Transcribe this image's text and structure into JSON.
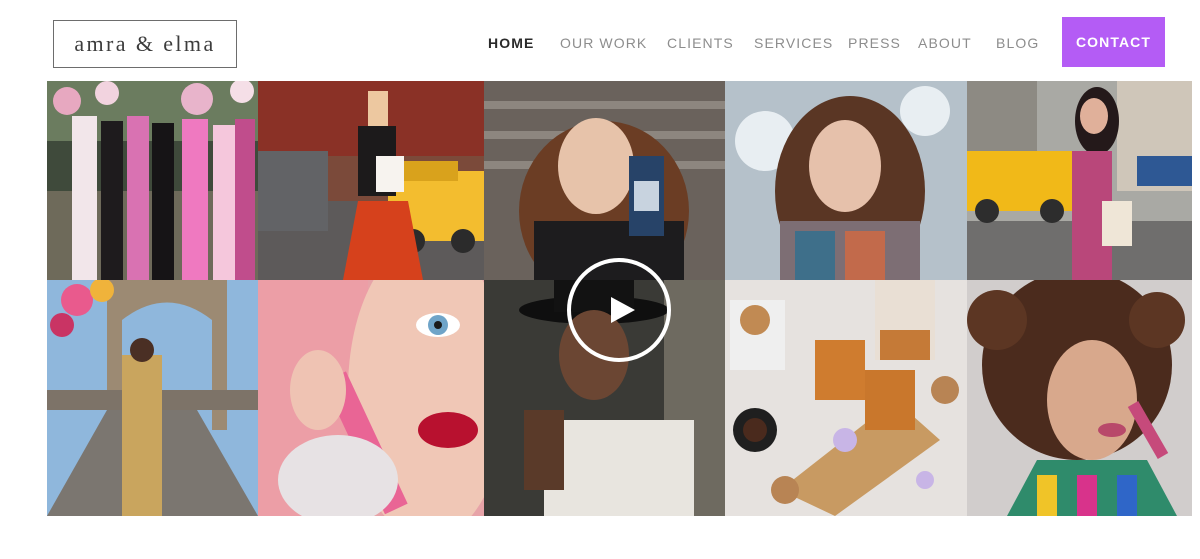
{
  "brand": {
    "logo_text": "amra & elma"
  },
  "nav": {
    "items": [
      {
        "label": "HOME",
        "active": true
      },
      {
        "label": "OUR WORK",
        "active": false
      },
      {
        "label": "CLIENTS",
        "active": false
      },
      {
        "label": "SERVICES",
        "active": false
      },
      {
        "label": "PRESS",
        "active": false
      },
      {
        "label": "ABOUT",
        "active": false
      },
      {
        "label": "BLOG",
        "active": false
      }
    ],
    "cta_label": "CONTACT",
    "cta_color": "#b45cf5"
  },
  "gallery": {
    "tiles": [
      {
        "name": "runway-group-photo"
      },
      {
        "name": "olay-street-photo"
      },
      {
        "name": "woman-snack-bar-photo"
      },
      {
        "name": "woman-winter-photo"
      },
      {
        "name": "woman-taxi-street-photo"
      },
      {
        "name": "woman-bridge-balloons-photo"
      },
      {
        "name": "lipstick-closeup-photo"
      },
      {
        "name": "man-hat-video-thumbnail"
      },
      {
        "name": "coffee-snacks-table-photo"
      },
      {
        "name": "curly-hair-lipgloss-photo"
      }
    ],
    "play_icon": "play-icon"
  }
}
